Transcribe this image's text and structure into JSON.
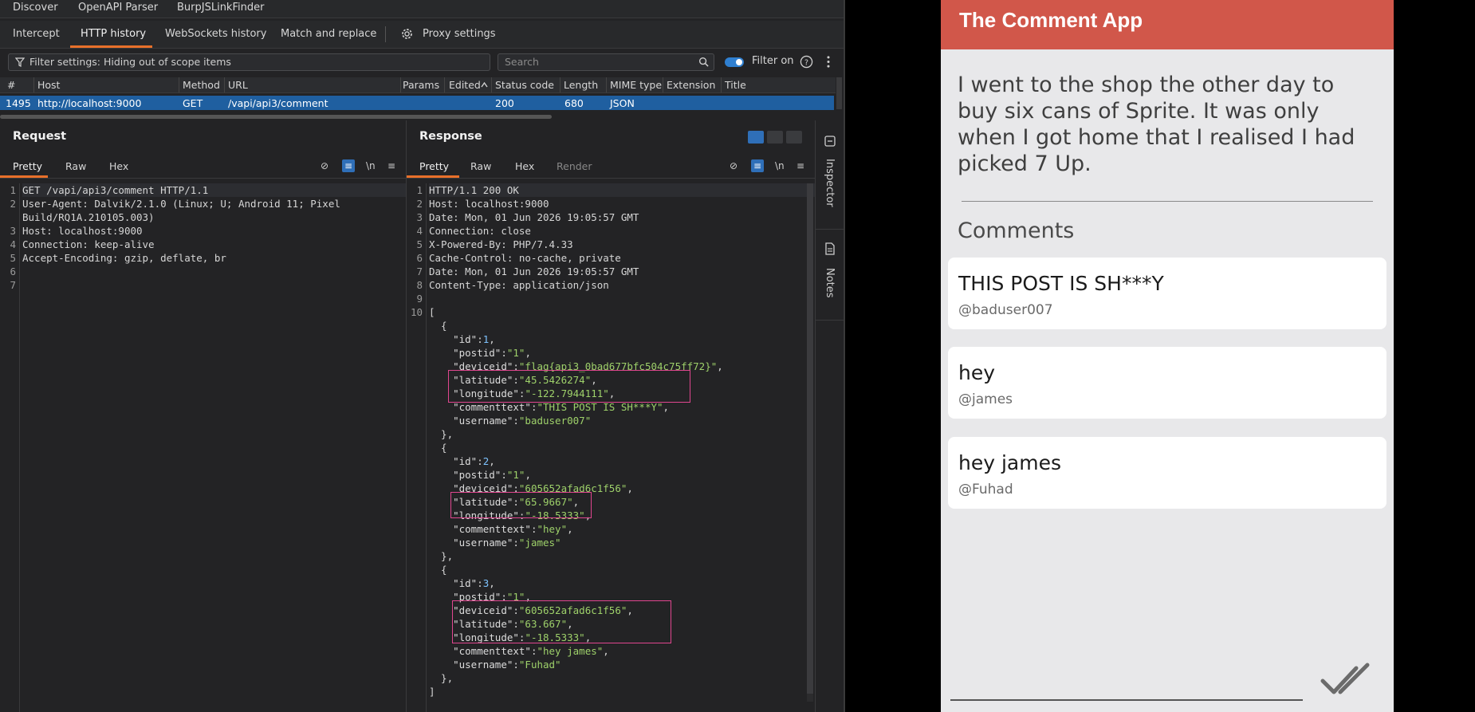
{
  "burp": {
    "top_tabs": [
      "Discover",
      "OpenAPI Parser",
      "BurpJSLinkFinder"
    ],
    "sub_tabs": [
      "Intercept",
      "HTTP history",
      "WebSockets history",
      "Match and replace"
    ],
    "proxy_settings": "Proxy settings",
    "filter_text": "Filter settings: Hiding out of scope items",
    "search_placeholder": "Search",
    "filter_on": "Filter on",
    "columns": [
      "#",
      "Host",
      "Method",
      "URL",
      "Params",
      "Edited",
      "Status code",
      "Length",
      "MIME type",
      "Extension",
      "Title"
    ],
    "row": {
      "num": "1495",
      "host": "http://localhost:9000",
      "method": "GET",
      "url": "/vapi/api3/comment",
      "status": "200",
      "length": "680",
      "mime": "JSON"
    },
    "request": {
      "title": "Request",
      "tabs": [
        "Pretty",
        "Raw",
        "Hex"
      ],
      "line_numbers": [
        "1",
        "2",
        "",
        "3",
        "4",
        "5",
        "6",
        "7"
      ],
      "lines": [
        "GET /vapi/api3/comment HTTP/1.1",
        "User-Agent: Dalvik/2.1.0 (Linux; U; Android 11; Pixel",
        "Build/RQ1A.210105.003)",
        "Host: localhost:9000",
        "Connection: keep-alive",
        "Accept-Encoding: gzip, deflate, br",
        "",
        ""
      ]
    },
    "response": {
      "title": "Response",
      "tabs": [
        "Pretty",
        "Raw",
        "Hex",
        "Render"
      ],
      "line_numbers": [
        "1",
        "2",
        "3",
        "4",
        "5",
        "6",
        "7",
        "8",
        "9",
        "10",
        "",
        "",
        "",
        "",
        "",
        "",
        "",
        "",
        "",
        "",
        "",
        "",
        "",
        "",
        "",
        "",
        "",
        "",
        "",
        "",
        "",
        "",
        "",
        "",
        "",
        "",
        "",
        ""
      ],
      "lines": [
        "HTTP/1.1 200 OK",
        "Host: localhost:9000",
        "Date: Mon, 01 Jun 2026 19:05:57 GMT",
        "Connection: close",
        "X-Powered-By: PHP/7.4.33",
        "Cache-Control: no-cache, private",
        "Date: Mon, 01 Jun 2026 19:05:57 GMT",
        "Content-Type: application/json",
        "",
        "[",
        "  {",
        "    \"id\":1,",
        "    \"postid\":\"1\",",
        "    \"deviceid\":\"flag{api3_0bad677bfc504c75ff72}\",",
        "    \"latitude\":\"45.5426274\",",
        "    \"longitude\":\"-122.7944111\",",
        "    \"commenttext\":\"THIS POST IS SH***Y\",",
        "    \"username\":\"baduser007\"",
        "  },",
        "  {",
        "    \"id\":2,",
        "    \"postid\":\"1\",",
        "    \"deviceid\":\"605652afad6c1f56\",",
        "    \"latitude\":\"65.9667\",",
        "    \"longitude\":\"-18.5333\",",
        "    \"commenttext\":\"hey\",",
        "    \"username\":\"james\"",
        "  },",
        "  {",
        "    \"id\":3,",
        "    \"postid\":\"1\",",
        "    \"deviceid\":\"605652afad6c1f56\",",
        "    \"latitude\":\"63.667\",",
        "    \"longitude\":\"-18.5333\",",
        "    \"commenttext\":\"hey james\",",
        "    \"username\":\"Fuhad\"",
        "  },",
        "]"
      ]
    },
    "side": [
      "Inspector",
      "Notes"
    ],
    "highlight_color": "#e0468f",
    "accent_color": "#e8702a"
  },
  "app": {
    "title": "The Comment App",
    "bar_color": "#d1574a",
    "post": "I went to the shop the other day to buy six cans of Sprite. It was only when I got home that I realised I had picked 7 Up.",
    "comments_heading": "Comments",
    "comments": [
      {
        "text": "THIS POST IS SH***Y",
        "user": "@baduser007"
      },
      {
        "text": "hey",
        "user": "@james"
      },
      {
        "text": "hey james",
        "user": "@Fuhad"
      }
    ]
  }
}
